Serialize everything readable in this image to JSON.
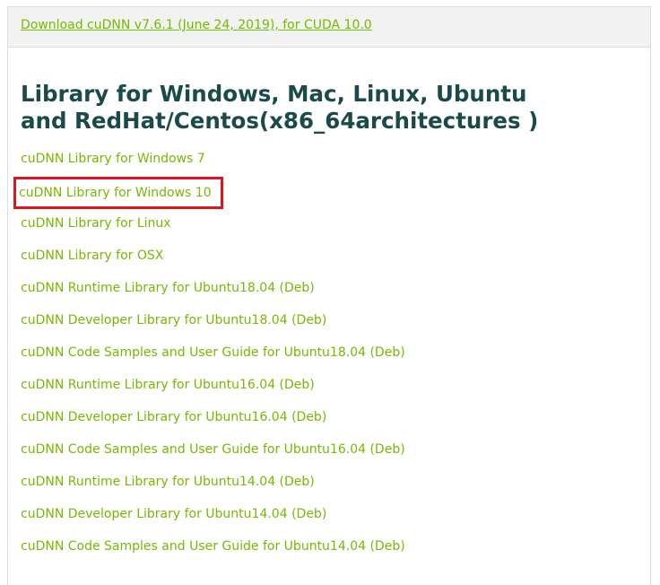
{
  "header": {
    "download_link": "Download cuDNN v7.6.1 (June 24, 2019), for CUDA 10.0"
  },
  "section": {
    "title": "Library for Windows, Mac, Linux, Ubuntu and RedHat/Centos(x86_64architectures )"
  },
  "links": [
    {
      "label": "cuDNN Library for Windows 7",
      "highlighted": false
    },
    {
      "label": "cuDNN Library for Windows 10",
      "highlighted": true
    },
    {
      "label": "cuDNN Library for Linux",
      "highlighted": false
    },
    {
      "label": "cuDNN Library for OSX",
      "highlighted": false
    },
    {
      "label": "cuDNN Runtime Library for Ubuntu18.04 (Deb)",
      "highlighted": false
    },
    {
      "label": "cuDNN Developer Library for Ubuntu18.04 (Deb)",
      "highlighted": false
    },
    {
      "label": "cuDNN Code Samples and User Guide for Ubuntu18.04 (Deb)",
      "highlighted": false
    },
    {
      "label": "cuDNN Runtime Library for Ubuntu16.04 (Deb)",
      "highlighted": false
    },
    {
      "label": "cuDNN Developer Library for Ubuntu16.04 (Deb)",
      "highlighted": false
    },
    {
      "label": "cuDNN Code Samples and User Guide for Ubuntu16.04 (Deb)",
      "highlighted": false
    },
    {
      "label": "cuDNN Runtime Library for Ubuntu14.04 (Deb)",
      "highlighted": false
    },
    {
      "label": "cuDNN Developer Library for Ubuntu14.04 (Deb)",
      "highlighted": false
    },
    {
      "label": "cuDNN Code Samples and User Guide for Ubuntu14.04 (Deb)",
      "highlighted": false
    }
  ],
  "colors": {
    "link_green": "#76b900",
    "title_teal": "#1a4a4a",
    "highlight_red": "#e0141b",
    "header_bg": "#f2f2f2"
  }
}
